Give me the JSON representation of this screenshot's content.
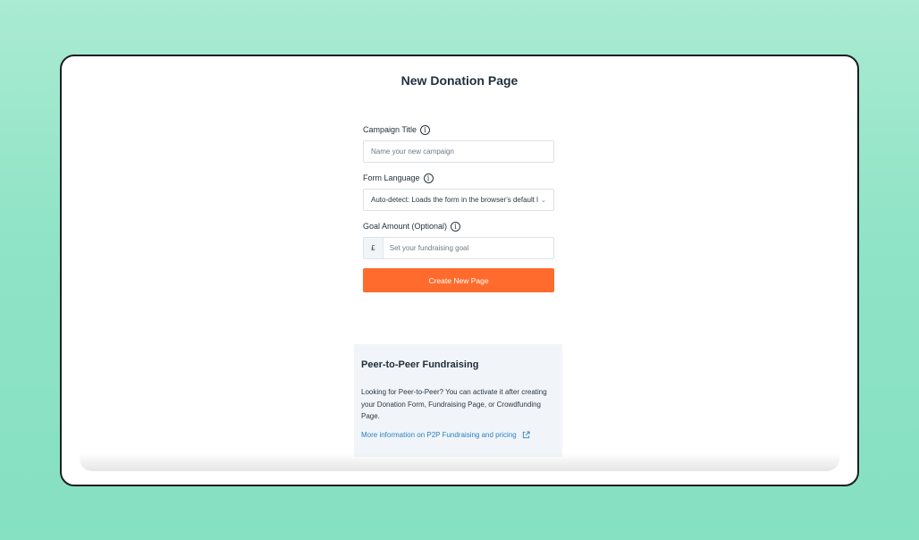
{
  "page": {
    "title": "New Donation Page"
  },
  "form": {
    "campaign_title": {
      "label": "Campaign Title",
      "placeholder": "Name your new campaign"
    },
    "form_language": {
      "label": "Form Language",
      "selected": "Auto-detect: Loads the form in the browser's default language"
    },
    "goal_amount": {
      "label": "Goal Amount (Optional)",
      "currency": "£",
      "placeholder": "Set your fundraising goal"
    },
    "submit_label": "Create New Page"
  },
  "p2p": {
    "title": "Peer-to-Peer Fundraising",
    "body": "Looking for Peer-to-Peer? You can activate it after creating your Donation Form, Fundraising Page, or Crowdfunding Page.",
    "link_text": "More information on P2P Fundraising and pricing"
  },
  "icons": {
    "info": "info-icon",
    "chevron": "chevron-down-icon",
    "external": "external-link-icon"
  },
  "colors": {
    "accent": "#ff6b2c",
    "link": "#2b7fc3",
    "background": "#8fe3c6"
  }
}
